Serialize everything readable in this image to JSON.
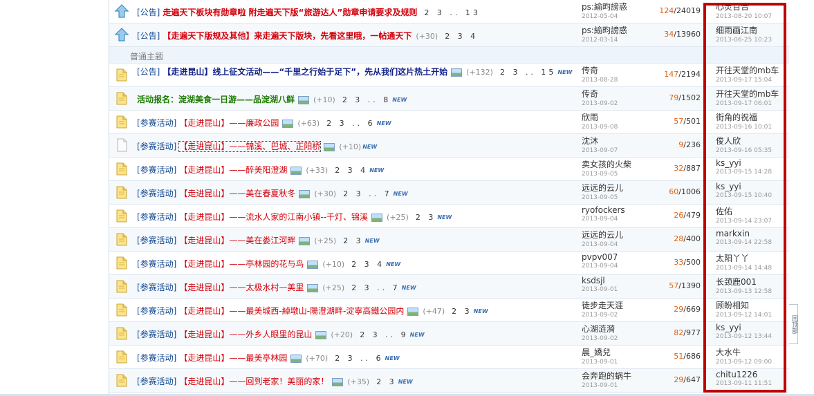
{
  "section_label": "普通主题",
  "side_tab_label": "回顶部",
  "threads": [
    {
      "type": "sticky",
      "prefix": "[公告]",
      "title": "走遍天下板块有勋章啦  附走遍天下版“旅游达人”勋章申请要求及规则",
      "title_style": "red",
      "has_pic": false,
      "plus": "",
      "pages": "2 3 .. 13",
      "new": "",
      "author": "ps:緰畇謗惑",
      "author_date": "2012-05-04",
      "replies": "124",
      "views": "24019",
      "last_user": "心灵百合",
      "last_date": "2013-08-20 10:07"
    },
    {
      "type": "sticky",
      "prefix": "[公告]",
      "title": "【走遍天下版规及其他】来走遍天下版块，先看这里哦，一帖通天下",
      "title_style": "red",
      "has_pic": false,
      "plus": "(+30)",
      "pages": "2 3 4",
      "new": "",
      "author": "ps:緰畇謗惑",
      "author_date": "2012-03-14",
      "replies": "34",
      "views": "13960",
      "last_user": "细雨画江南",
      "last_date": "2013-06-25 10:23"
    },
    {
      "type": "normal",
      "prefix": "[公告]",
      "title": "【走进昆山】线上征文活动——“千里之行始于足下”，先从我们这片热土开始",
      "title_style": "blue",
      "has_pic": true,
      "plus": "(+132)",
      "pages": "2 3 .. 15",
      "new": "NEW",
      "author": "传奇",
      "author_date": "2013-08-28",
      "replies": "147",
      "views": "2194",
      "last_user": "开往天堂的mb车",
      "last_date": "2013-09-17 15:04"
    },
    {
      "type": "normal",
      "prefix": "",
      "title": "活动报名：淀湖美食一日游——品淀湖八鲜",
      "title_style": "green",
      "has_pic": true,
      "plus": "(+10)",
      "pages": "2 3 .. 8",
      "new": "NEW",
      "author": "传奇",
      "author_date": "2013-09-02",
      "replies": "79",
      "views": "1502",
      "last_user": "开往天堂的mb车",
      "last_date": "2013-09-17 06:01"
    },
    {
      "type": "normal",
      "prefix": "[参赛活动]",
      "title": "【走进昆山】——廉政公园",
      "title_style": "red",
      "has_pic": true,
      "plus": "(+63)",
      "pages": "2 3 .. 6",
      "new": "NEW",
      "author": "欣雨",
      "author_date": "2013-09-08",
      "replies": "57",
      "views": "501",
      "last_user": "街角的祝福",
      "last_date": "2013-09-16 10:01"
    },
    {
      "type": "plain",
      "prefix": "[参赛活动]",
      "title": "【走进昆山】——锦溪、巴城、正阳桥",
      "title_style": "red",
      "has_pic": true,
      "plus": "(+10)",
      "pages": "",
      "new": "NEW",
      "author": "沈沐",
      "author_date": "2013-09-07",
      "replies": "9",
      "views": "236",
      "last_user": "俊人欣",
      "last_date": "2013-09-16 05:35"
    },
    {
      "type": "normal",
      "prefix": "[参赛活动]",
      "title": "【走进昆山】——醉美阳澄湖",
      "title_style": "red",
      "has_pic": true,
      "plus": "(+33)",
      "pages": "2 3 4",
      "new": "NEW",
      "author": "卖女孩的火柴",
      "author_date": "2013-09-05",
      "replies": "32",
      "views": "887",
      "last_user": "ks_yyi",
      "last_date": "2013-09-15 14:28"
    },
    {
      "type": "normal",
      "prefix": "[参赛活动]",
      "title": "【走进昆山】——美在春夏秋冬",
      "title_style": "red",
      "has_pic": true,
      "plus": "(+30)",
      "pages": "2 3 .. 7",
      "new": "NEW",
      "author": "远远的云儿",
      "author_date": "2013-09-05",
      "replies": "60",
      "views": "1006",
      "last_user": "ks_yyi",
      "last_date": "2013-09-15 10:40"
    },
    {
      "type": "normal",
      "prefix": "[参赛活动]",
      "title": "【走进昆山】——流水人家的江南小镇--千灯、锦溪",
      "title_style": "red",
      "has_pic": true,
      "plus": "(+25)",
      "pages": "2 3",
      "new": "NEW",
      "author": "ryofockers",
      "author_date": "2013-09-04",
      "replies": "26",
      "views": "479",
      "last_user": "佐佑",
      "last_date": "2013-09-14 23:07"
    },
    {
      "type": "normal",
      "prefix": "[参赛活动]",
      "title": "【走进昆山】——美在娄江河畔",
      "title_style": "red",
      "has_pic": true,
      "plus": "(+25)",
      "pages": "2 3",
      "new": "NEW",
      "author": "远远的云儿",
      "author_date": "2013-09-04",
      "replies": "28",
      "views": "400",
      "last_user": "markxin",
      "last_date": "2013-09-14 22:58"
    },
    {
      "type": "normal",
      "prefix": "[参赛活动]",
      "title": "【走进昆山】——亭林园的花与鸟",
      "title_style": "red",
      "has_pic": true,
      "plus": "(+10)",
      "pages": "2 3 4",
      "new": "NEW",
      "author": "pvpv007",
      "author_date": "2013-09-04",
      "replies": "33",
      "views": "500",
      "last_user": "太阳丫丫",
      "last_date": "2013-09-14 14:48"
    },
    {
      "type": "normal",
      "prefix": "[参赛活动]",
      "title": "【走进昆山】——太极水村—美里",
      "title_style": "red",
      "has_pic": true,
      "plus": "(+25)",
      "pages": "2 3 .. 7",
      "new": "NEW",
      "author": "ksdsjl",
      "author_date": "2013-09-01",
      "replies": "57",
      "views": "1390",
      "last_user": "长颈鹿001",
      "last_date": "2013-09-13 12:58"
    },
    {
      "type": "normal",
      "prefix": "[参赛活动]",
      "title": "【走进昆山】——最美城西-綽墩山-陽澄湖畔-淀寧高鐵公园内",
      "title_style": "red",
      "has_pic": true,
      "plus": "(+47)",
      "pages": "2 3",
      "new": "NEW",
      "author": "徒步走天涯",
      "author_date": "2013-09-02",
      "replies": "29",
      "views": "669",
      "last_user": "顾盼相知",
      "last_date": "2013-09-12 14:01"
    },
    {
      "type": "normal",
      "prefix": "[参赛活动]",
      "title": "【走进昆山】——外乡人眼里的昆山",
      "title_style": "red",
      "has_pic": true,
      "plus": "(+20)",
      "pages": "2 3 .. 9",
      "new": "NEW",
      "author": "心湖涟漪",
      "author_date": "2013-09-02",
      "replies": "82",
      "views": "977",
      "last_user": "ks_yyi",
      "last_date": "2013-09-12 13:44"
    },
    {
      "type": "normal",
      "prefix": "[参赛活动]",
      "title": "【走进昆山】——最美亭林园",
      "title_style": "red",
      "has_pic": true,
      "plus": "(+70)",
      "pages": "2 3 .. 6",
      "new": "NEW",
      "author": "晨_嬌兒",
      "author_date": "2013-09-01",
      "replies": "51",
      "views": "686",
      "last_user": "大水牛",
      "last_date": "2013-09-12 09:00"
    },
    {
      "type": "normal",
      "prefix": "[参赛活动]",
      "title": "【走进昆山】——回到老家！美丽的家！",
      "title_style": "red",
      "has_pic": true,
      "plus": "(+35)",
      "pages": "2 3",
      "new": "NEW",
      "author": "会奔跑的蜗牛",
      "author_date": "2013-09-01",
      "replies": "29",
      "views": "647",
      "last_user": "chitu1226",
      "last_date": "2013-09-11 11:51"
    }
  ],
  "colors": {
    "accent_red": "#d4000a",
    "highlight_box": "#c00000",
    "prefix_blue": "#0c4590",
    "replies_orange": "#e2600a"
  }
}
